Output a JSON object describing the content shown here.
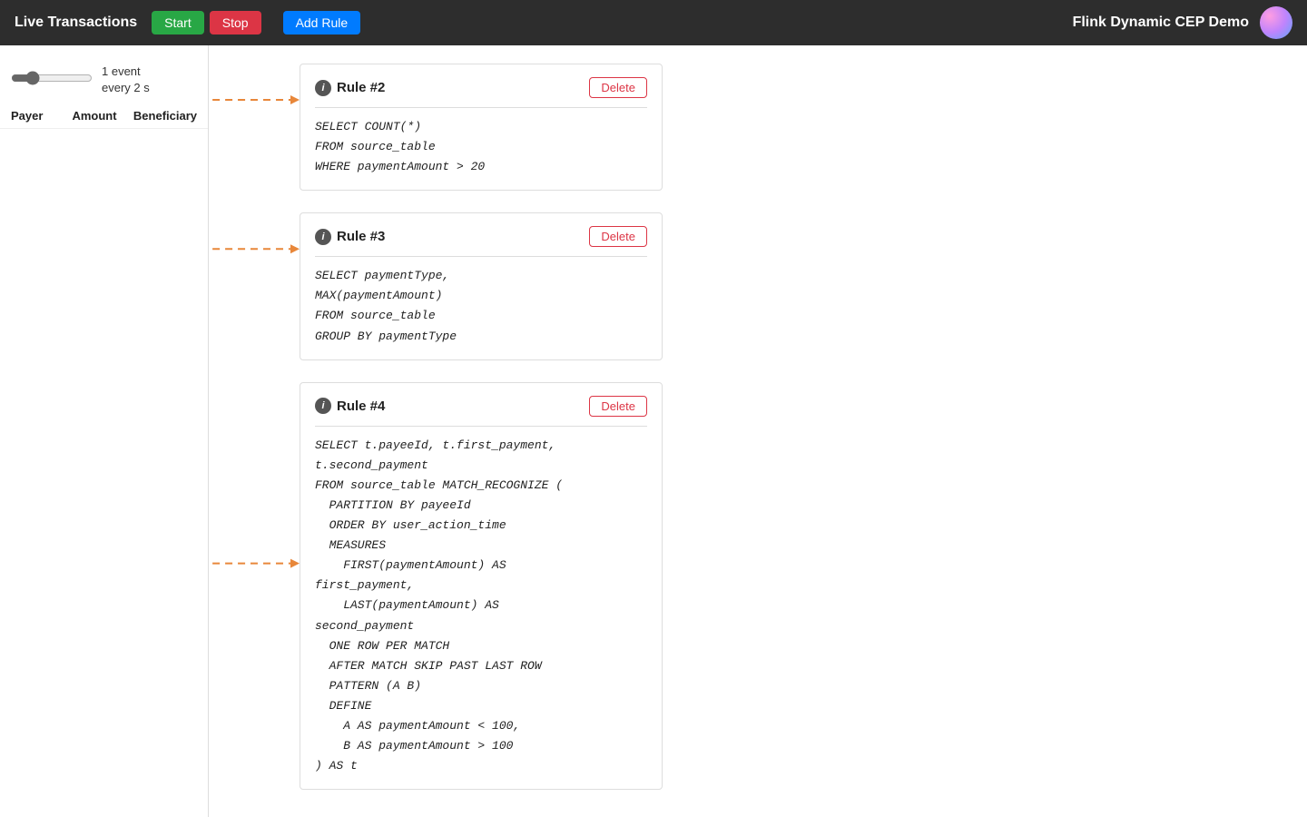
{
  "header": {
    "title": "Live Transactions",
    "start_label": "Start",
    "stop_label": "Stop",
    "add_rule_label": "Add Rule",
    "demo_title": "Flink Dynamic CEP Demo"
  },
  "left_panel": {
    "speed_text_line1": "1 event",
    "speed_text_line2": "every 2 s",
    "columns": [
      "Payer",
      "Amount",
      "Beneficiary"
    ]
  },
  "rules": [
    {
      "id": "rule-2",
      "title": "Rule #2",
      "delete_label": "Delete",
      "code_lines": [
        "SELECT COUNT(*)",
        "FROM source_table",
        "WHERE paymentAmount > 20"
      ]
    },
    {
      "id": "rule-3",
      "title": "Rule #3",
      "delete_label": "Delete",
      "code_lines": [
        "SELECT paymentType,",
        "MAX(paymentAmount)",
        "FROM source_table",
        "GROUP BY paymentType"
      ]
    },
    {
      "id": "rule-4",
      "title": "Rule #4",
      "delete_label": "Delete",
      "code_lines": [
        "SELECT t.payeeId, t.first_payment,",
        "t.second_payment",
        "FROM source_table MATCH_RECOGNIZE (",
        "  PARTITION BY payeeId",
        "  ORDER BY user_action_time",
        "  MEASURES",
        "    FIRST(paymentAmount) AS",
        "first_payment,",
        "    LAST(paymentAmount) AS",
        "second_payment",
        "  ONE ROW PER MATCH",
        "  AFTER MATCH SKIP PAST LAST ROW",
        "  PATTERN (A B)",
        "  DEFINE",
        "    A AS paymentAmount < 100,",
        "    B AS paymentAmount > 100",
        ") AS t"
      ]
    }
  ],
  "colors": {
    "arrow_color": "#e8873a",
    "delete_color": "#dc3545",
    "start_color": "#28a745",
    "stop_color": "#dc3545",
    "add_rule_color": "#007bff"
  }
}
